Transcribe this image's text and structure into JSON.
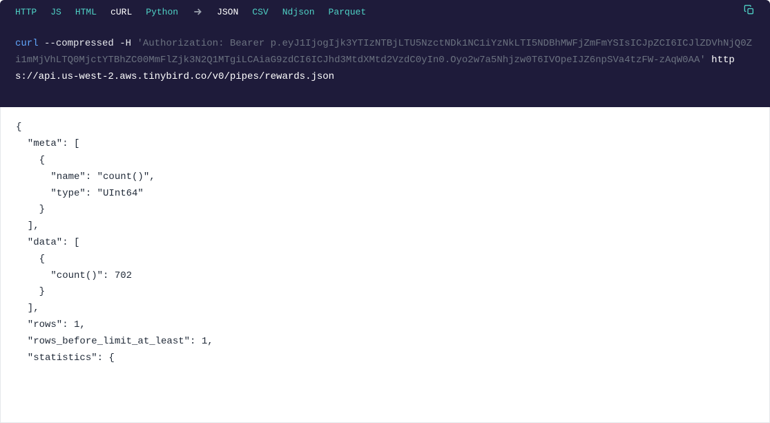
{
  "tabs": {
    "http": "HTTP",
    "js": "JS",
    "html": "HTML",
    "curl": "cURL",
    "python": "Python",
    "json": "JSON",
    "csv": "CSV",
    "ndjson": "Ndjson",
    "parquet": "Parquet"
  },
  "code": {
    "curl": "curl",
    "flags": "--compressed -H",
    "auth": "'Authorization: Bearer p.eyJ1IjogIjk3YTIzNTBjLTU5NzctNDk1NC1iYzNkLTI5NDBhMWFjZmFmYSIsICJpZCI6ICJlZDVhNjQ0Zi1mMjVhLTQ0MjctYTBhZC00MmFlZjk3N2Q1MTgiLCAiaG9zdCI6ICJhd3MtdXMtd2VzdC0yIn0.Oyo2w7a5Nhjzw0T6IVOpeIJZ6npSVa4tzFW-zAqW0AA'",
    "url": "https://api.us-west-2.aws.tinybird.co/v0/pipes/rewards.json"
  },
  "output": "{\n  \"meta\": [\n    {\n      \"name\": \"count()\",\n      \"type\": \"UInt64\"\n    }\n  ],\n  \"data\": [\n    {\n      \"count()\": 702\n    }\n  ],\n  \"rows\": 1,\n  \"rows_before_limit_at_least\": 1,\n  \"statistics\": {"
}
